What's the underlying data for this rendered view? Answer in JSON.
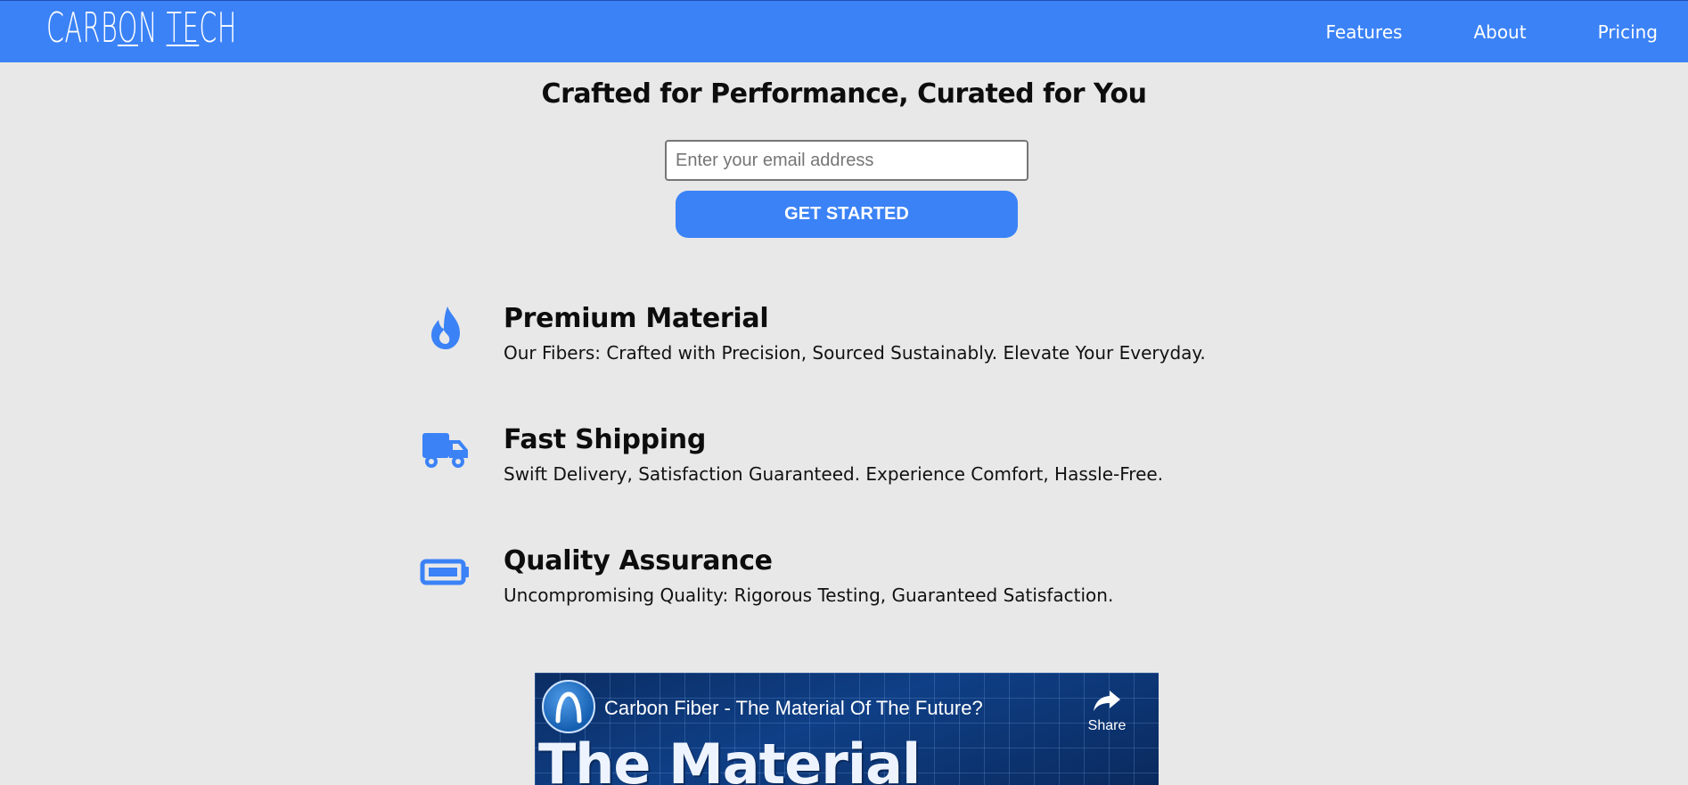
{
  "header": {
    "logo_part1": "CARB",
    "logo_part2": "O",
    "logo_part3": "N ",
    "logo_part4": "TE",
    "logo_part5": "CH",
    "nav": [
      {
        "label": "Features"
      },
      {
        "label": "About"
      },
      {
        "label": "Pricing"
      }
    ],
    "bg_color": "#3b82f6"
  },
  "hero": {
    "title": "Crafted for Performance, Curated for You",
    "email_placeholder": "Enter your email address",
    "cta_label": "GET STARTED"
  },
  "features": [
    {
      "icon": "flame-icon",
      "title": "Premium Material",
      "description": "Our Fibers: Crafted with Precision, Sourced Sustainably. Elevate Your Everyday."
    },
    {
      "icon": "truck-icon",
      "title": "Fast Shipping",
      "description": "Swift Delivery, Satisfaction Guaranteed. Experience Comfort, Hassle-Free."
    },
    {
      "icon": "battery-icon",
      "title": "Quality Assurance",
      "description": "Uncompromising Quality: Rigorous Testing, Guaranteed Satisfaction."
    }
  ],
  "video": {
    "title": "Carbon Fiber - The Material Of The Future?",
    "share_label": "Share",
    "thumbnail_text": "The Material"
  },
  "accent_color": "#3b82f6"
}
